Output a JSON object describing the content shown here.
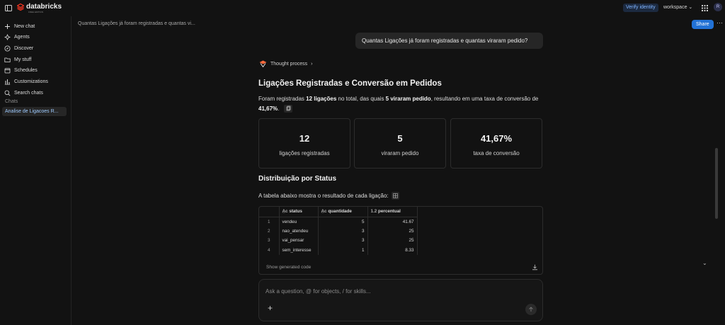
{
  "topbar": {
    "logo_text": "databricks",
    "logo_sub": "FREE EDITION",
    "verify_label": "Verify identity",
    "workspace_label": "workspace",
    "avatar_initial": "R"
  },
  "sidebar": {
    "items": [
      {
        "label": "New chat",
        "icon": "plus-icon"
      },
      {
        "label": "Agents",
        "icon": "agents-icon"
      },
      {
        "label": "Discover",
        "icon": "compass-icon"
      },
      {
        "label": "My stuff",
        "icon": "folder-icon"
      },
      {
        "label": "Schedules",
        "icon": "calendar-icon"
      },
      {
        "label": "Customizations",
        "icon": "bars-icon"
      },
      {
        "label": "Search chats",
        "icon": "search-icon"
      }
    ],
    "section_label": "Chats",
    "chats": [
      {
        "label": "Analise de Ligacoes R..."
      }
    ]
  },
  "main": {
    "breadcrumb": "Quantas Ligações já foram registradas e quantas vi...",
    "share_label": "Share",
    "user_message": "Quantas Ligações já foram registradas e quantas viraram pedido?",
    "thought_label": "Thought process",
    "title": "Ligações Registradas e Conversão em Pedidos",
    "summary": {
      "p1": "Foram registradas ",
      "b1": "12 ligações",
      "p2": " no total, das quais ",
      "b2": "5 viraram pedido",
      "p3": ", resultando em uma taxa de conversão de ",
      "b3": "41,67%",
      "p4": "."
    },
    "cards": [
      {
        "value": "12",
        "label": "ligações registradas"
      },
      {
        "value": "5",
        "label": "viraram pedido"
      },
      {
        "value": "41,67%",
        "label": "taxa de conversão"
      }
    ],
    "section_title": "Distribuição por Status",
    "table_intro": "A tabela abaixo mostra o resultado de cada ligação:",
    "table": {
      "columns": [
        {
          "label": "status",
          "type_badge": "A̲c"
        },
        {
          "label": "quantidade",
          "type_badge": "A̲c"
        },
        {
          "label": "percentual",
          "type_badge": "1.2"
        }
      ],
      "rows": [
        {
          "idx": "1",
          "status": "vendeu",
          "quantidade": "5",
          "percentual": "41.67"
        },
        {
          "idx": "2",
          "status": "nao_atendeu",
          "quantidade": "3",
          "percentual": "25"
        },
        {
          "idx": "3",
          "status": "vai_pensar",
          "quantidade": "3",
          "percentual": "25"
        },
        {
          "idx": "4",
          "status": "sem_interesse",
          "quantidade": "1",
          "percentual": "8.33"
        }
      ],
      "show_code_label": "Show generated code"
    },
    "input_placeholder": "Ask a question, @ for objects, / for skills..."
  }
}
